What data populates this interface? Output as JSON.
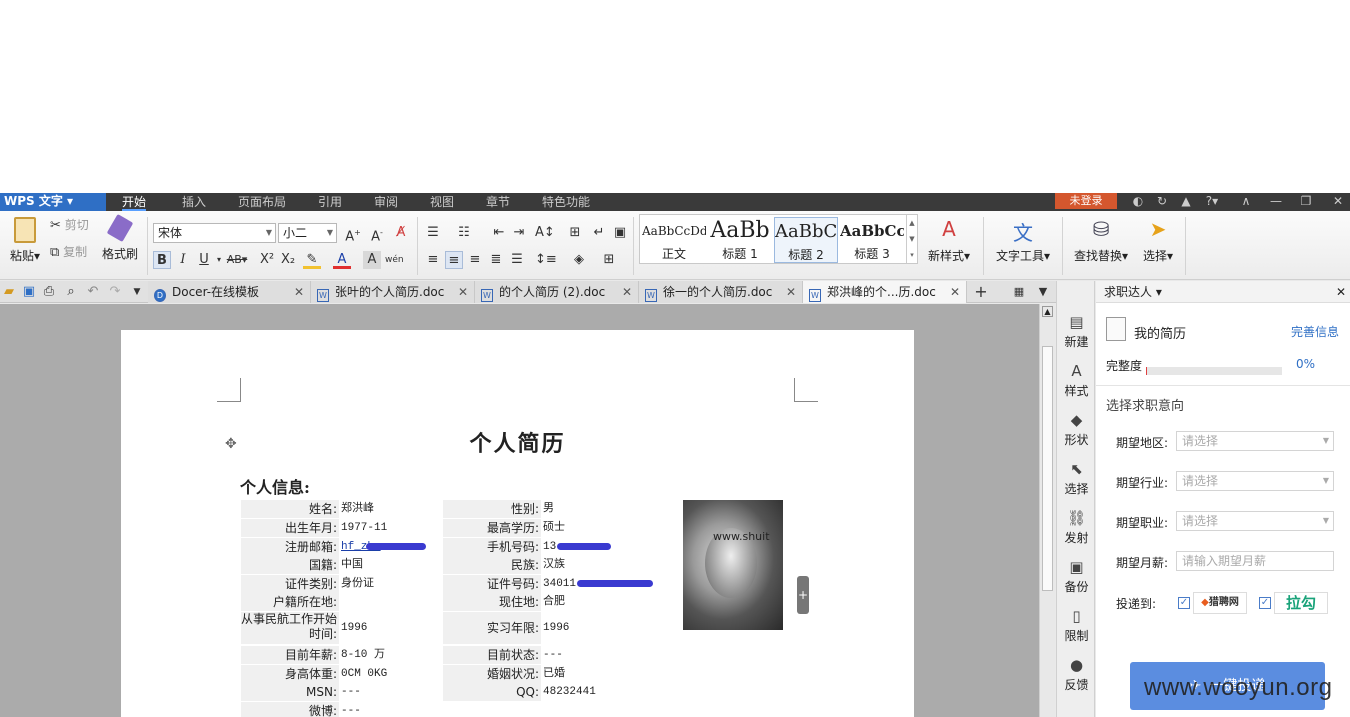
{
  "app": {
    "logo": "WPS 文字",
    "login": "未登录"
  },
  "menu_tabs": [
    "开始",
    "插入",
    "页面布局",
    "引用",
    "审阅",
    "视图",
    "章节",
    "特色功能"
  ],
  "ribbon": {
    "paste": "粘贴",
    "cut": "剪切",
    "copy": "复制",
    "format_painter": "格式刷",
    "font_name": "宋体",
    "font_size": "小二",
    "styles": [
      {
        "preview": "AaBbCcDd",
        "name": "正文"
      },
      {
        "preview": "AaBb",
        "name": "标题 1"
      },
      {
        "preview": "AaBbC",
        "name": "标题 2"
      },
      {
        "preview": "AaBbCcI",
        "name": "标题 3"
      }
    ],
    "new_style": "新样式",
    "text_tools": "文字工具",
    "find_replace": "查找替换",
    "select": "选择"
  },
  "doc_tabs": [
    "Docer-在线模板",
    "张叶的个人简历.doc",
    "的个人简历 (2).doc",
    "徐一的个人简历.doc",
    "郑洪峰的个...历.doc"
  ],
  "document": {
    "title": "个人简历",
    "section": "个人信息:",
    "left_rows": [
      {
        "label": "姓名:",
        "value": "郑洪峰"
      },
      {
        "label": "出生年月:",
        "value": "1977-11"
      },
      {
        "label": "注册邮箱:",
        "value": "hf_zhe"
      },
      {
        "label": "国籍:",
        "value": "中国"
      },
      {
        "label": "证件类别:",
        "value": "身份证"
      },
      {
        "label": "户籍所在地:",
        "value": ""
      },
      {
        "label": "从事民航工作开始时间:",
        "value": "1996"
      },
      {
        "label": "目前年薪:",
        "value": "8-10 万"
      },
      {
        "label": "身高体重:",
        "value": "0CM 0KG"
      },
      {
        "label": "MSN:",
        "value": "---"
      },
      {
        "label": "微博:",
        "value": "---"
      }
    ],
    "right_rows": [
      {
        "label": "性别:",
        "value": "男"
      },
      {
        "label": "最高学历:",
        "value": "硕士"
      },
      {
        "label": "手机号码:",
        "value": "13"
      },
      {
        "label": "民族:",
        "value": "汉族"
      },
      {
        "label": "证件号码:",
        "value": "34011"
      },
      {
        "label": "现住地:",
        "value": "合肥"
      },
      {
        "label": "实习年限:",
        "value": "1996"
      },
      {
        "label": "目前状态:",
        "value": "---"
      },
      {
        "label": "婚姻状况:",
        "value": "已婚"
      },
      {
        "label": "QQ:",
        "value": "48232441"
      }
    ],
    "photo_watermark": "www.shuit"
  },
  "side_strip": [
    "新建",
    "样式",
    "形状",
    "选择",
    "发射",
    "备份",
    "限制",
    "反馈"
  ],
  "panel": {
    "header": "求职达人",
    "resume_title": "我的简历",
    "complete_link": "完善信息",
    "progress_label": "完整度",
    "progress_value": 0,
    "progress_text": "0%",
    "intent_title": "选择求职意向",
    "fields": [
      {
        "label": "期望地区:",
        "placeholder": "请选择"
      },
      {
        "label": "期望行业:",
        "placeholder": "请选择"
      },
      {
        "label": "期望职业:",
        "placeholder": "请选择"
      },
      {
        "label": "期望月薪:",
        "placeholder": "请输入期望月薪"
      }
    ],
    "deliver_label": "投递到:",
    "sites": [
      "猎聘网",
      "拉勾"
    ],
    "send_button": "一键投递"
  },
  "watermark": "www.wooyun.org",
  "colors": {
    "accent": "#2f6fc5",
    "login": "#d4572e",
    "send": "#5b8de0",
    "redact": "#3a3ad0"
  }
}
